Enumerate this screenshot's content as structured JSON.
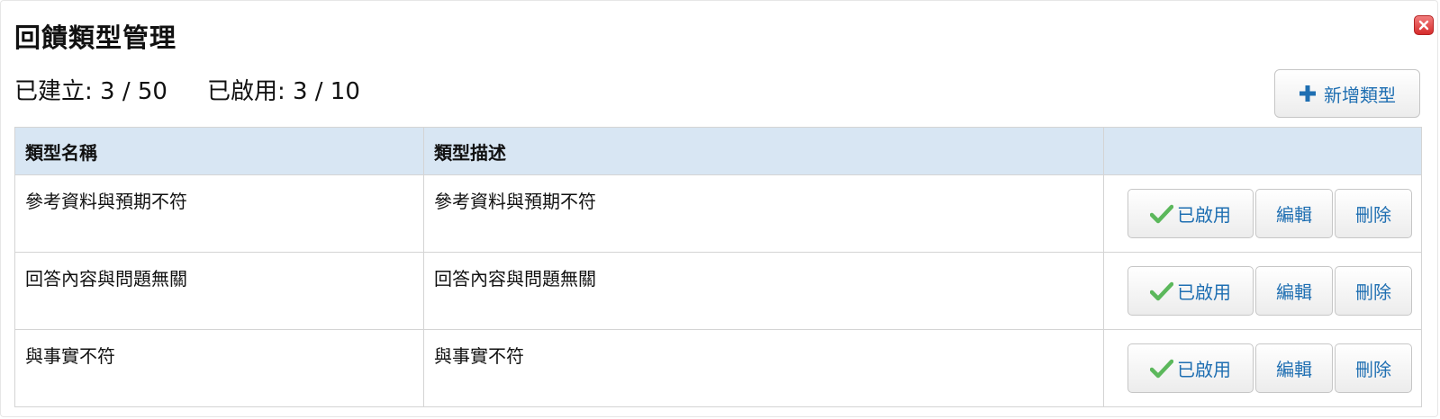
{
  "dialog": {
    "title": "回饋類型管理",
    "close_icon": "close-icon",
    "colors": {
      "accent": "#1f6fb2",
      "header_bg": "#d8e6f3",
      "close_bg": "#d62c2c",
      "check": "#5cb85c"
    }
  },
  "stats": {
    "created_label": "已建立: 3 / 50",
    "enabled_label": "已啟用: 3 / 10"
  },
  "toolbar": {
    "add_icon": "plus-icon",
    "add_label": "新增類型"
  },
  "table": {
    "columns": [
      "類型名稱",
      "類型描述",
      ""
    ],
    "rows": [
      {
        "name": "參考資料與預期不符",
        "description": "參考資料與預期不符",
        "status_label": "已啟用",
        "status_icon": "check-icon",
        "edit_label": "編輯",
        "delete_label": "刪除"
      },
      {
        "name": "回答內容與問題無關",
        "description": "回答內容與問題無關",
        "status_label": "已啟用",
        "status_icon": "check-icon",
        "edit_label": "編輯",
        "delete_label": "刪除"
      },
      {
        "name": "與事實不符",
        "description": "與事實不符",
        "status_label": "已啟用",
        "status_icon": "check-icon",
        "edit_label": "編輯",
        "delete_label": "刪除"
      }
    ]
  }
}
